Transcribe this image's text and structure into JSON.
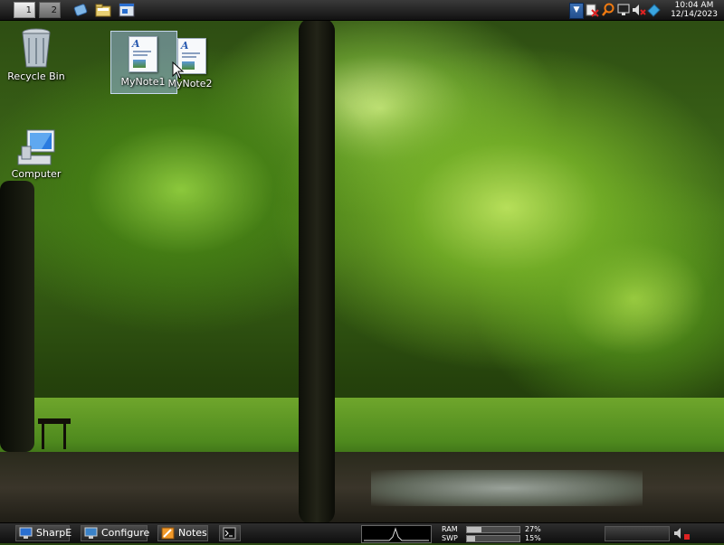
{
  "top_panel": {
    "workspaces": [
      "1",
      "2"
    ],
    "quick_launch": [
      "eraser-icon",
      "file-manager-icon",
      "window-icon"
    ],
    "tray_icons": [
      "tray-arrow-icon",
      "network-disconnected-icon",
      "search-icon",
      "display-icon",
      "volume-muted-icon",
      "app-icon"
    ],
    "clock": {
      "time": "10:04 AM",
      "date": "12/14/2023"
    }
  },
  "desktop": {
    "icons": [
      {
        "label": "Recycle Bin",
        "icon": "recycle-bin-icon"
      },
      {
        "label": "Computer",
        "icon": "computer-icon"
      },
      {
        "label": "MyNote1",
        "icon": "document-icon",
        "selected": true
      },
      {
        "label": "MyNote2",
        "icon": "document-icon"
      }
    ]
  },
  "taskbar": {
    "buttons": [
      {
        "label": "SharpE",
        "icon": "sharpe-icon"
      },
      {
        "label": "Configure",
        "icon": "configure-icon"
      },
      {
        "label": "Notes",
        "icon": "notes-icon"
      },
      {
        "label": "",
        "icon": "terminal-icon"
      }
    ],
    "meters": {
      "ram": {
        "label": "RAM",
        "percent_text": "27%",
        "fraction": 0.27
      },
      "swp": {
        "label": "SWP",
        "percent_text": "15%",
        "fraction": 0.15
      }
    }
  },
  "colors": {
    "selection": "#96b4dc",
    "panel": "#1a1a1a",
    "accent": "#2a6fd0"
  }
}
